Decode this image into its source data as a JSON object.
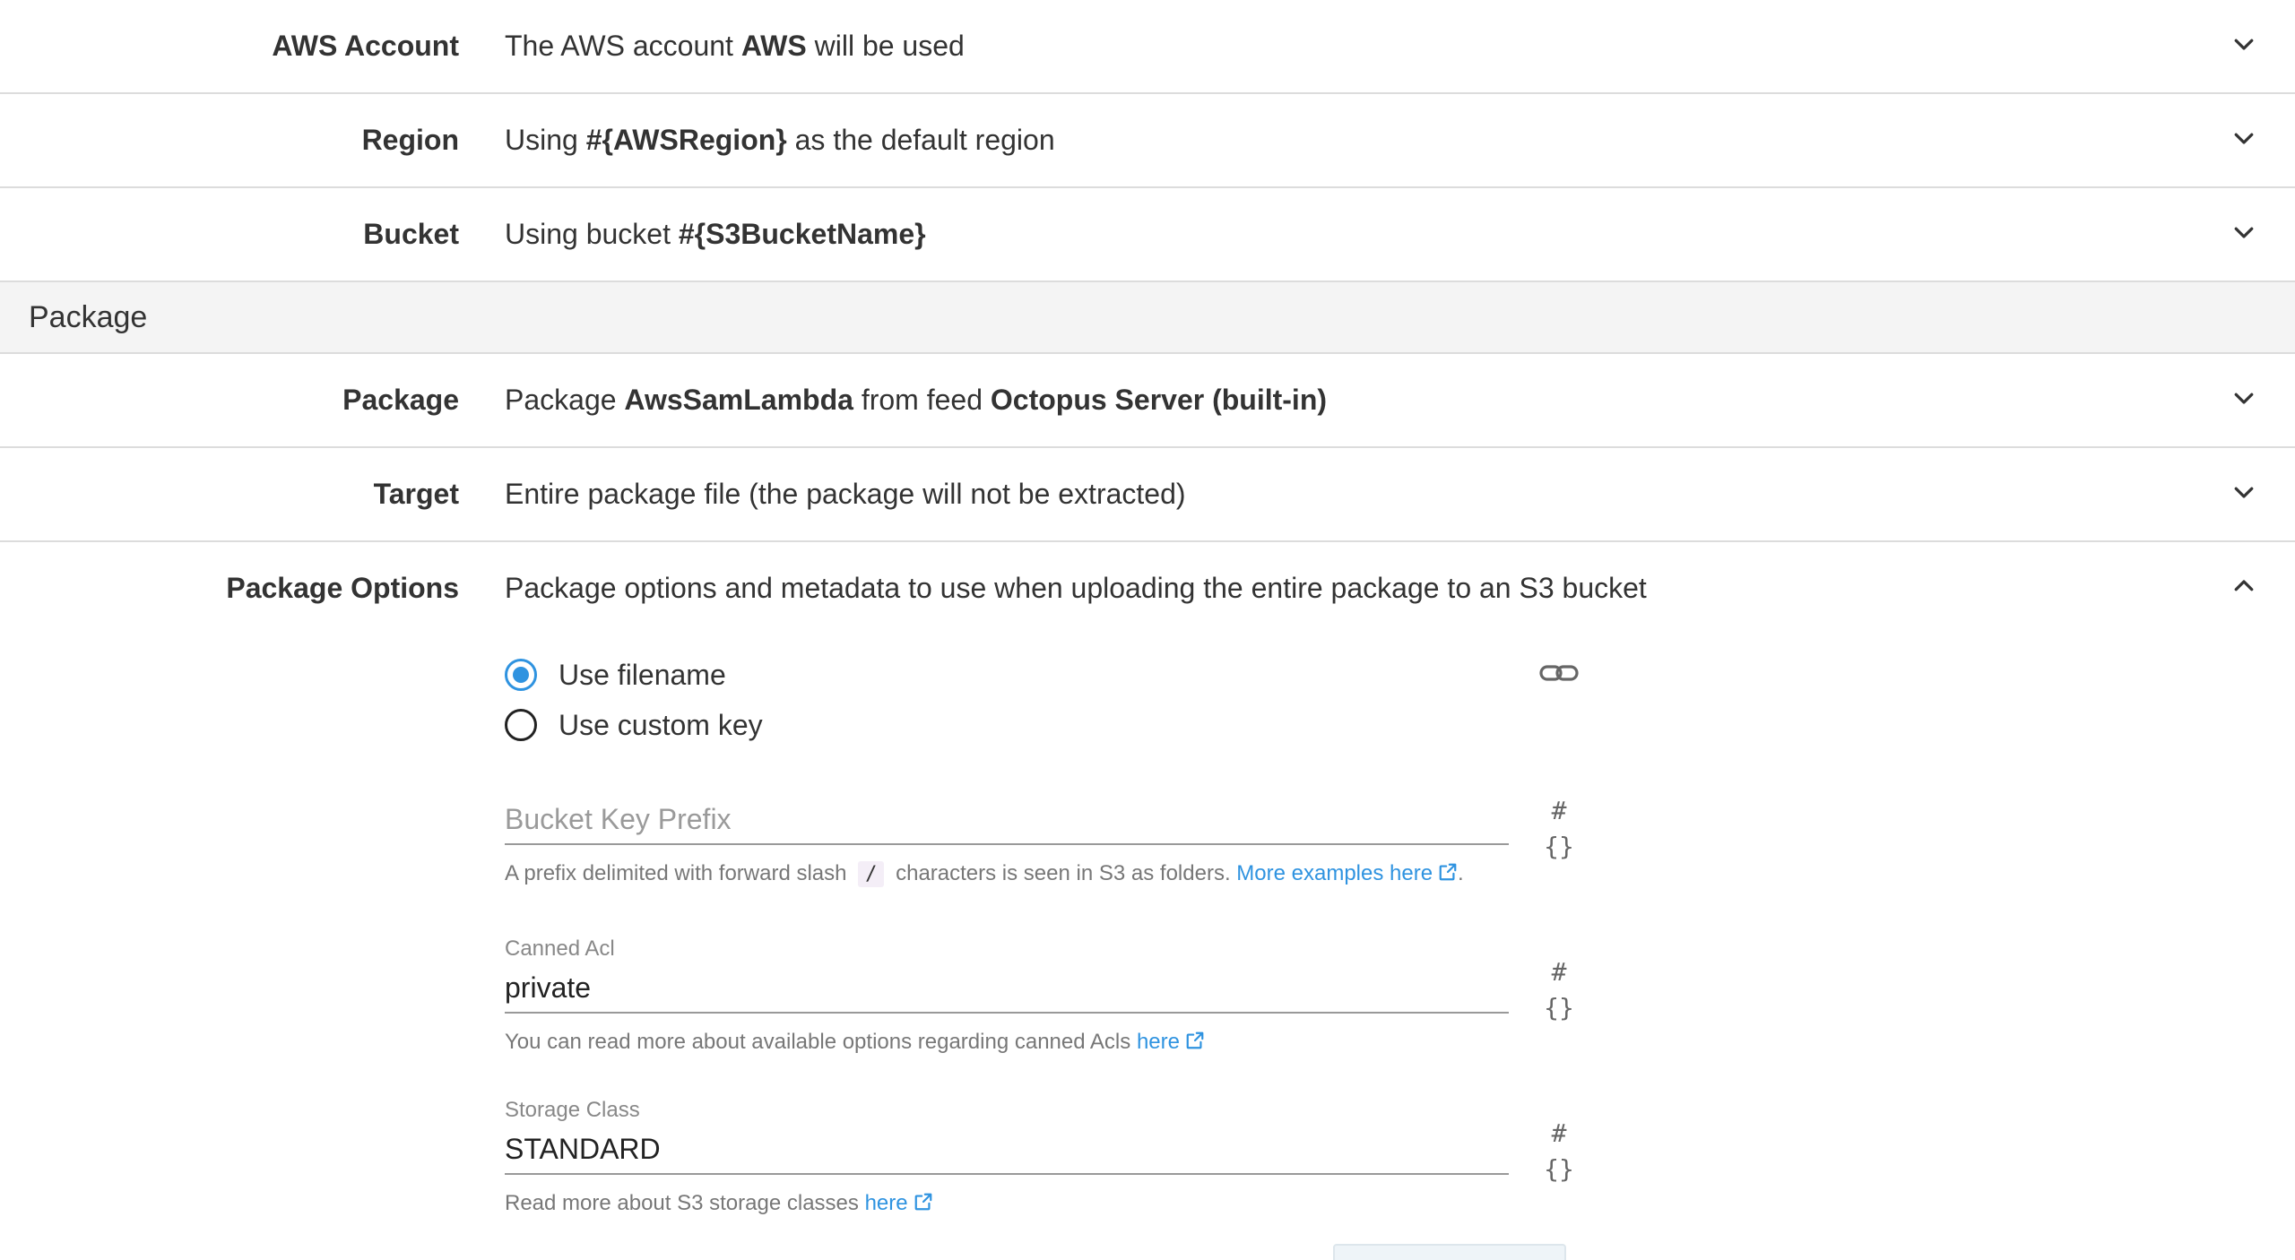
{
  "rows": [
    {
      "label": "AWS Account",
      "summary_pre": "The AWS account ",
      "summary_bold": "AWS",
      "summary_post": " will be used"
    },
    {
      "label": "Region",
      "summary_pre": "Using ",
      "summary_bold": "#{AWSRegion}",
      "summary_post": " as the default region"
    },
    {
      "label": "Bucket",
      "summary_pre": "Using bucket ",
      "summary_bold": "#{S3BucketName}",
      "summary_post": ""
    }
  ],
  "section": {
    "title": "Package"
  },
  "package_rows": [
    {
      "label": "Package",
      "summary_pre": "Package ",
      "summary_bold": "AwsSamLambda",
      "summary_mid": " from feed ",
      "summary_bold2": "Octopus Server (built-in)"
    },
    {
      "label": "Target",
      "summary": "Entire package file (the package will not be extracted)"
    }
  ],
  "package_options": {
    "label": "Package Options",
    "summary": "Package options and metadata to use when uploading the entire package to an S3 bucket",
    "radios": [
      {
        "label": "Use filename",
        "checked": true
      },
      {
        "label": "Use custom key",
        "checked": false
      }
    ],
    "bind_symbol": "#{}",
    "bucket_key_prefix": {
      "placeholder": "Bucket Key Prefix",
      "value": "",
      "help_pre": "A prefix delimited with forward slash",
      "help_code": "/",
      "help_mid": "characters is seen in S3 as folders.",
      "help_link": "More examples here",
      "help_post": "."
    },
    "canned_acl": {
      "label": "Canned Acl",
      "value": "private",
      "help_pre": "You can read more about available options regarding canned Acls",
      "help_link": "here"
    },
    "storage_class": {
      "label": "Storage Class",
      "value": "STANDARD",
      "help_pre": "Read more about S3 storage classes",
      "help_link": "here"
    }
  },
  "colors": {
    "accent": "#2f93e0",
    "text": "#333333",
    "divider": "#dcdcdc",
    "section_bg": "#f4f4f4"
  }
}
